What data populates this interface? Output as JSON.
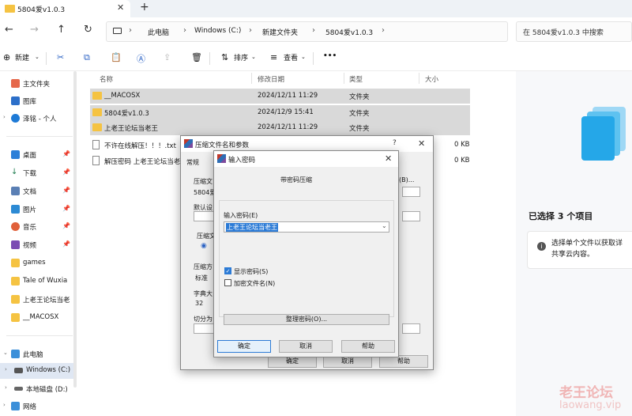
{
  "tab": {
    "title": "5804爱v1.0.3",
    "close": "✕",
    "add": "+"
  },
  "nav": {
    "back": "←",
    "forward": "→",
    "up": "↑",
    "refresh": "↻",
    "breadcrumbs": [
      "此电脑",
      "Windows (C:)",
      "新建文件夹",
      "5804爱v1.0.3"
    ],
    "search_placeholder": "在 5804爱v1.0.3 中搜索"
  },
  "toolbar": {
    "new": "新建",
    "sort": "排序",
    "view": "查看",
    "more": "•••"
  },
  "sidebar": {
    "top": [
      {
        "label": "主文件夹"
      },
      {
        "label": "图库"
      },
      {
        "label": "泽铭 - 个人"
      }
    ],
    "pinned": [
      {
        "label": "桌面"
      },
      {
        "label": "下载"
      },
      {
        "label": "文档"
      },
      {
        "label": "图片"
      },
      {
        "label": "音乐"
      },
      {
        "label": "视频"
      },
      {
        "label": "games"
      },
      {
        "label": "Tale of Wuxia"
      },
      {
        "label": "上老王论坛当老"
      },
      {
        "label": "__MACOSX"
      }
    ],
    "drives": [
      {
        "label": "此电脑"
      },
      {
        "label": "Windows (C:)"
      },
      {
        "label": "本地磁盘 (D:)"
      },
      {
        "label": "网络"
      }
    ]
  },
  "filelist": {
    "columns": [
      "名称",
      "修改日期",
      "类型",
      "大小"
    ],
    "rows": [
      {
        "name": "__MACOSX",
        "date": "2024/12/11 11:29",
        "type": "文件夹",
        "size": ""
      },
      {
        "name": "5804爱v1.0.3",
        "date": "2024/12/9 15:41",
        "type": "文件夹",
        "size": ""
      },
      {
        "name": "上老王论坛当老王",
        "date": "2024/12/11 11:29",
        "type": "文件夹",
        "size": ""
      },
      {
        "name": "不许在线解压！！！.txt",
        "date": "",
        "type": "",
        "size": "0 KB"
      },
      {
        "name": "解压密码 上老王论坛当老",
        "date": "",
        "type": "",
        "size": "0 KB"
      }
    ]
  },
  "details": {
    "title": "已选择 3 个项目",
    "line1": "选择单个文件以获取详",
    "line2": "共享云内容。",
    "info_icon": "i"
  },
  "back_dialog": {
    "title": "压缩文件名和参数",
    "help_mark": "?",
    "close": "✕",
    "tab_general": "常规",
    "archive_label": "压缩文",
    "archive_value": "5804爱",
    "browse": "(B)...",
    "default_label": "默认设",
    "format_label": "压缩文",
    "method_label": "压缩方",
    "method_value": "标准",
    "dict_label": "字典大",
    "dict_value": "32",
    "split_label": "切分为",
    "ok": "确定",
    "cancel": "取消",
    "help": "帮助"
  },
  "password_dialog": {
    "title": "输入密码",
    "close": "✕",
    "header": "带密码压缩",
    "enter_label": "输入密码(E)",
    "password_value": "上老王论坛当老王",
    "show_password": "显示密码(S)",
    "encrypt_names": "加密文件名(N)",
    "organize": "整理密码(O)...",
    "ok": "确定",
    "cancel": "取消",
    "help": "帮助"
  },
  "watermark": {
    "line1": "老王论坛",
    "line2": "laowang.vip"
  }
}
